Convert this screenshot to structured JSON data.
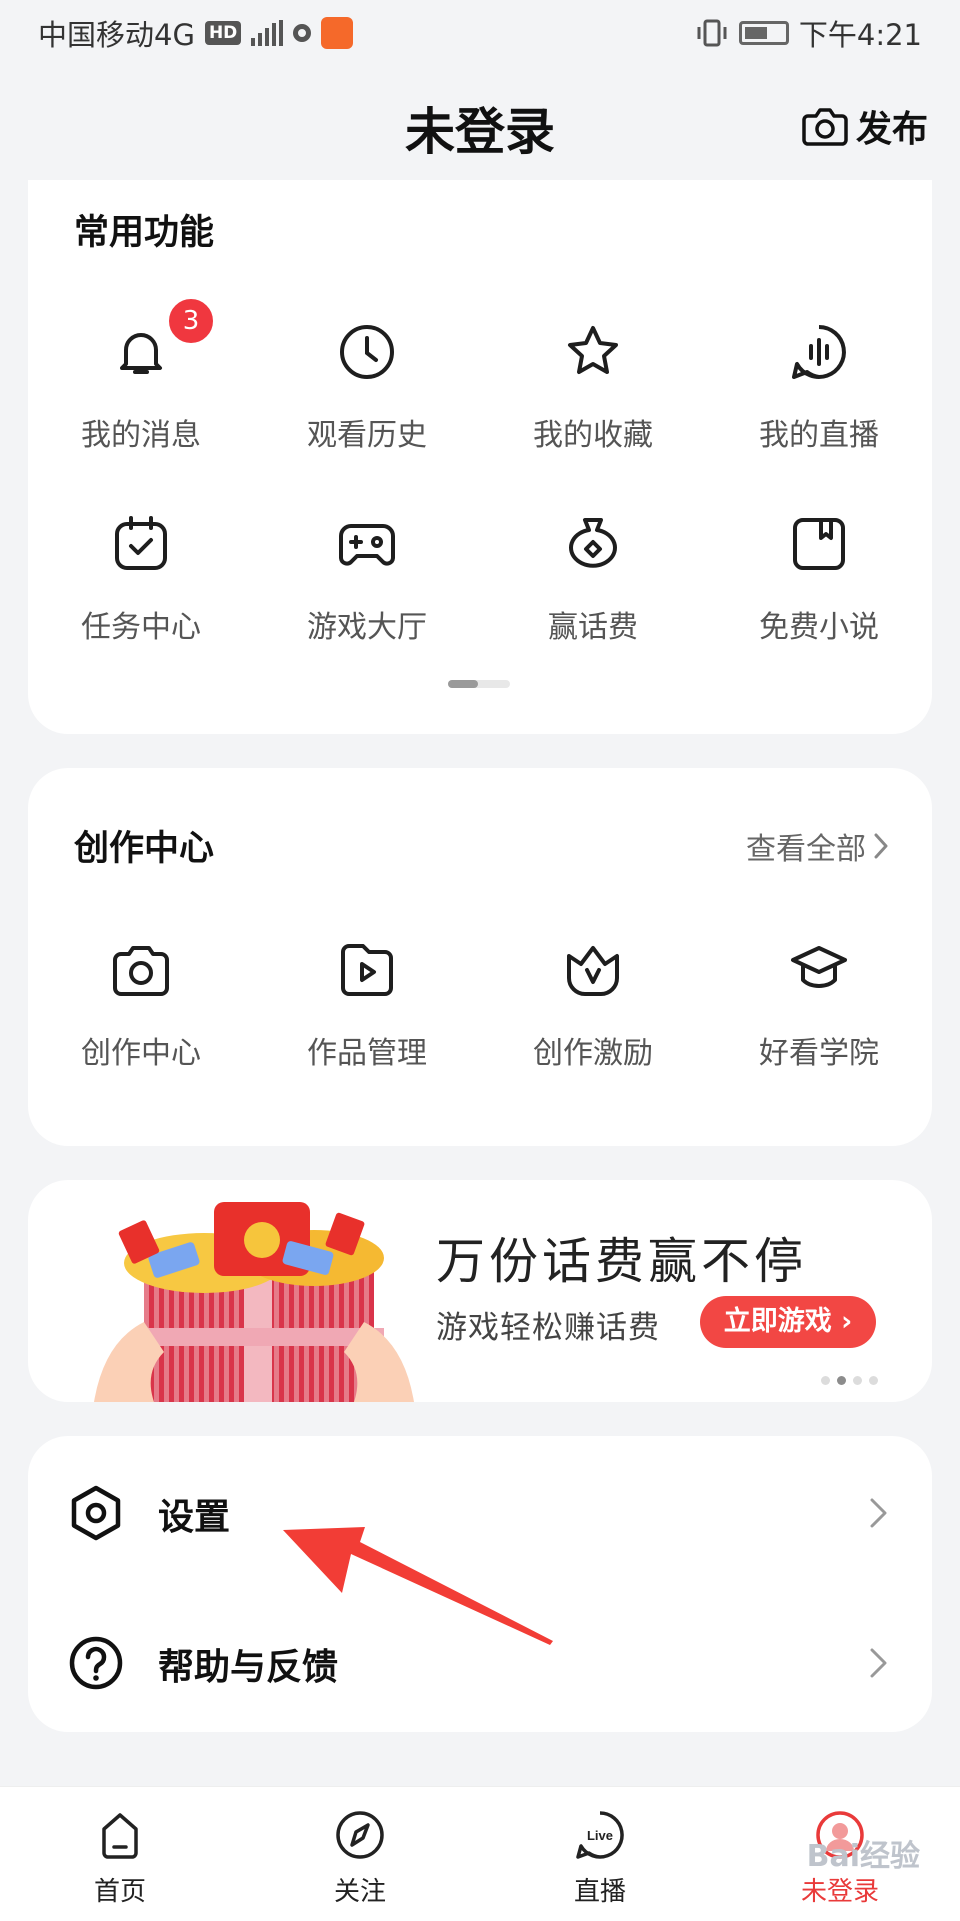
{
  "status_bar": {
    "carrier": "中国移动4G",
    "hd_badge": "HD",
    "time": "下午4:21"
  },
  "header": {
    "title": "未登录",
    "publish_label": "发布"
  },
  "frequent": {
    "title": "常用功能",
    "items": [
      {
        "label": "我的消息",
        "icon": "bell-icon",
        "badge": "3"
      },
      {
        "label": "观看历史",
        "icon": "clock-icon"
      },
      {
        "label": "我的收藏",
        "icon": "star-icon"
      },
      {
        "label": "我的直播",
        "icon": "live-wave-icon"
      },
      {
        "label": "任务中心",
        "icon": "task-check-icon"
      },
      {
        "label": "游戏大厅",
        "icon": "gamepad-icon"
      },
      {
        "label": "赢话费",
        "icon": "money-bag-icon"
      },
      {
        "label": "免费小说",
        "icon": "book-icon"
      }
    ]
  },
  "create": {
    "title": "创作中心",
    "see_all": "查看全部",
    "items": [
      {
        "label": "创作中心",
        "icon": "camera-icon"
      },
      {
        "label": "作品管理",
        "icon": "video-folder-icon"
      },
      {
        "label": "创作激励",
        "icon": "crown-icon"
      },
      {
        "label": "好看学院",
        "icon": "graduation-cap-icon"
      }
    ]
  },
  "banner": {
    "title": "万份话费赢不停",
    "subtitle": "游戏轻松赚话费",
    "button": "立即游戏 ›",
    "page_count": 4,
    "active_page": 2
  },
  "settings_list": [
    {
      "label": "设置",
      "icon": "settings-icon"
    },
    {
      "label": "帮助与反馈",
      "icon": "help-icon"
    }
  ],
  "tabbar": [
    {
      "label": "首页",
      "icon": "home-icon"
    },
    {
      "label": "关注",
      "icon": "compass-icon"
    },
    {
      "label": "直播",
      "icon": "live-icon"
    },
    {
      "label": "未登录",
      "icon": "avatar-icon",
      "active": true
    }
  ],
  "colors": {
    "accent_red": "#e93a3a",
    "badge_red": "#f0373f",
    "background": "#f3f4f6"
  },
  "watermark": "Bai经验"
}
